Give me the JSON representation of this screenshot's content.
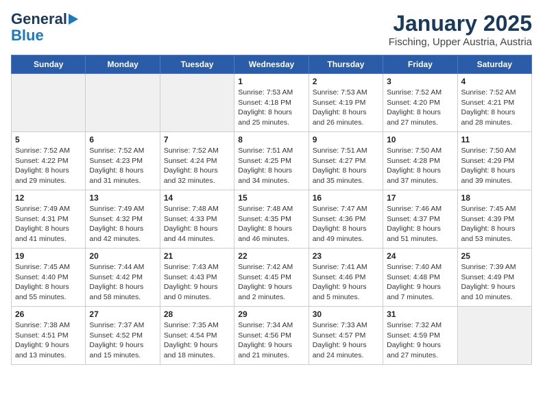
{
  "logo": {
    "line1": "General",
    "line2": "Blue"
  },
  "title": "January 2025",
  "subtitle": "Fisching, Upper Austria, Austria",
  "days_of_week": [
    "Sunday",
    "Monday",
    "Tuesday",
    "Wednesday",
    "Thursday",
    "Friday",
    "Saturday"
  ],
  "weeks": [
    [
      {
        "day": "",
        "empty": true
      },
      {
        "day": "",
        "empty": true
      },
      {
        "day": "",
        "empty": true
      },
      {
        "day": "1",
        "info": "Sunrise: 7:53 AM\nSunset: 4:18 PM\nDaylight: 8 hours\nand 25 minutes."
      },
      {
        "day": "2",
        "info": "Sunrise: 7:53 AM\nSunset: 4:19 PM\nDaylight: 8 hours\nand 26 minutes."
      },
      {
        "day": "3",
        "info": "Sunrise: 7:52 AM\nSunset: 4:20 PM\nDaylight: 8 hours\nand 27 minutes."
      },
      {
        "day": "4",
        "info": "Sunrise: 7:52 AM\nSunset: 4:21 PM\nDaylight: 8 hours\nand 28 minutes."
      }
    ],
    [
      {
        "day": "5",
        "info": "Sunrise: 7:52 AM\nSunset: 4:22 PM\nDaylight: 8 hours\nand 29 minutes."
      },
      {
        "day": "6",
        "info": "Sunrise: 7:52 AM\nSunset: 4:23 PM\nDaylight: 8 hours\nand 31 minutes."
      },
      {
        "day": "7",
        "info": "Sunrise: 7:52 AM\nSunset: 4:24 PM\nDaylight: 8 hours\nand 32 minutes."
      },
      {
        "day": "8",
        "info": "Sunrise: 7:51 AM\nSunset: 4:25 PM\nDaylight: 8 hours\nand 34 minutes."
      },
      {
        "day": "9",
        "info": "Sunrise: 7:51 AM\nSunset: 4:27 PM\nDaylight: 8 hours\nand 35 minutes."
      },
      {
        "day": "10",
        "info": "Sunrise: 7:50 AM\nSunset: 4:28 PM\nDaylight: 8 hours\nand 37 minutes."
      },
      {
        "day": "11",
        "info": "Sunrise: 7:50 AM\nSunset: 4:29 PM\nDaylight: 8 hours\nand 39 minutes."
      }
    ],
    [
      {
        "day": "12",
        "info": "Sunrise: 7:49 AM\nSunset: 4:31 PM\nDaylight: 8 hours\nand 41 minutes."
      },
      {
        "day": "13",
        "info": "Sunrise: 7:49 AM\nSunset: 4:32 PM\nDaylight: 8 hours\nand 42 minutes."
      },
      {
        "day": "14",
        "info": "Sunrise: 7:48 AM\nSunset: 4:33 PM\nDaylight: 8 hours\nand 44 minutes."
      },
      {
        "day": "15",
        "info": "Sunrise: 7:48 AM\nSunset: 4:35 PM\nDaylight: 8 hours\nand 46 minutes."
      },
      {
        "day": "16",
        "info": "Sunrise: 7:47 AM\nSunset: 4:36 PM\nDaylight: 8 hours\nand 49 minutes."
      },
      {
        "day": "17",
        "info": "Sunrise: 7:46 AM\nSunset: 4:37 PM\nDaylight: 8 hours\nand 51 minutes."
      },
      {
        "day": "18",
        "info": "Sunrise: 7:45 AM\nSunset: 4:39 PM\nDaylight: 8 hours\nand 53 minutes."
      }
    ],
    [
      {
        "day": "19",
        "info": "Sunrise: 7:45 AM\nSunset: 4:40 PM\nDaylight: 8 hours\nand 55 minutes."
      },
      {
        "day": "20",
        "info": "Sunrise: 7:44 AM\nSunset: 4:42 PM\nDaylight: 8 hours\nand 58 minutes."
      },
      {
        "day": "21",
        "info": "Sunrise: 7:43 AM\nSunset: 4:43 PM\nDaylight: 9 hours\nand 0 minutes."
      },
      {
        "day": "22",
        "info": "Sunrise: 7:42 AM\nSunset: 4:45 PM\nDaylight: 9 hours\nand 2 minutes."
      },
      {
        "day": "23",
        "info": "Sunrise: 7:41 AM\nSunset: 4:46 PM\nDaylight: 9 hours\nand 5 minutes."
      },
      {
        "day": "24",
        "info": "Sunrise: 7:40 AM\nSunset: 4:48 PM\nDaylight: 9 hours\nand 7 minutes."
      },
      {
        "day": "25",
        "info": "Sunrise: 7:39 AM\nSunset: 4:49 PM\nDaylight: 9 hours\nand 10 minutes."
      }
    ],
    [
      {
        "day": "26",
        "info": "Sunrise: 7:38 AM\nSunset: 4:51 PM\nDaylight: 9 hours\nand 13 minutes."
      },
      {
        "day": "27",
        "info": "Sunrise: 7:37 AM\nSunset: 4:52 PM\nDaylight: 9 hours\nand 15 minutes."
      },
      {
        "day": "28",
        "info": "Sunrise: 7:35 AM\nSunset: 4:54 PM\nDaylight: 9 hours\nand 18 minutes."
      },
      {
        "day": "29",
        "info": "Sunrise: 7:34 AM\nSunset: 4:56 PM\nDaylight: 9 hours\nand 21 minutes."
      },
      {
        "day": "30",
        "info": "Sunrise: 7:33 AM\nSunset: 4:57 PM\nDaylight: 9 hours\nand 24 minutes."
      },
      {
        "day": "31",
        "info": "Sunrise: 7:32 AM\nSunset: 4:59 PM\nDaylight: 9 hours\nand 27 minutes."
      },
      {
        "day": "",
        "empty": true
      }
    ]
  ]
}
